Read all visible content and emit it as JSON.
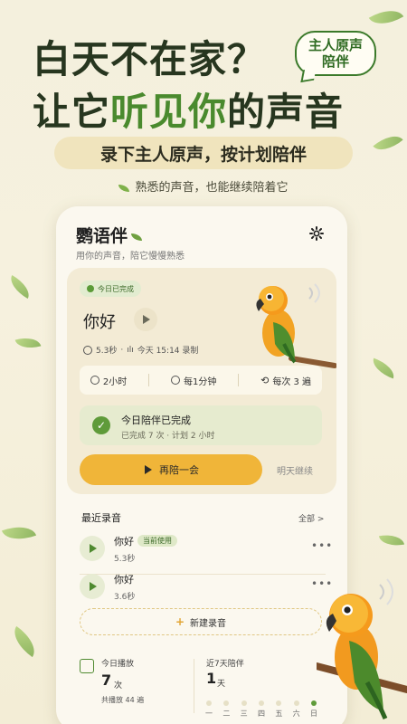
{
  "hero": {
    "line1": "白天不在家？",
    "line2_prefix": "让它",
    "line2_green": "听见你",
    "line2_suffix": "的声音",
    "bubble_line1": "主人原声",
    "bubble_line2": "陪伴",
    "banner": "录下主人原声，按计划陪伴",
    "tagline": "熟悉的声音，也能继续陪着它"
  },
  "app": {
    "title": "鹦语伴",
    "subtitle": "用你的声音，陪它慢慢熟悉",
    "settings_icon": "gear-icon"
  },
  "today": {
    "chip": "今日已完成",
    "recording_name": "你好",
    "duration": "5.3秒",
    "recorded_at": "今天 15:14 录制",
    "schedule": {
      "interval": "2小时",
      "frequency": "每1分钟",
      "repeat": "每次 3 遍"
    },
    "complete_title": "今日陪伴已完成",
    "complete_sub": "已完成 7 次 · 计划 2 小时",
    "again_button": "再陪一会",
    "tomorrow_link": "明天继续"
  },
  "recent": {
    "heading": "最近录音",
    "all_link": "全部 >",
    "items": [
      {
        "name": "你好",
        "badge": "当前使用",
        "duration": "5.3秒"
      },
      {
        "name": "你好",
        "badge": "",
        "duration": "3.6秒"
      }
    ],
    "new_button": "新建录音"
  },
  "stats": {
    "today_label": "今日播放",
    "today_count": "7",
    "today_unit": "次",
    "total": "共播放 44 遍",
    "week_label": "近7天陪伴",
    "week_count": "1",
    "week_unit": "天",
    "days": [
      "一",
      "二",
      "三",
      "四",
      "五",
      "六",
      "日"
    ],
    "active": [
      false,
      false,
      false,
      false,
      false,
      false,
      true
    ]
  },
  "colors": {
    "accent_green": "#4a8a2e",
    "button_yellow": "#f0b539",
    "title_dark": "#27361f"
  }
}
